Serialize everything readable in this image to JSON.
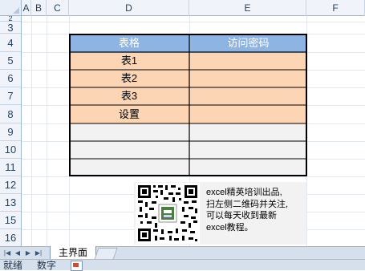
{
  "columns": [
    "A",
    "B",
    "C",
    "D",
    "E",
    "F"
  ],
  "rows": [
    "2",
    "3",
    "4",
    "5",
    "6",
    "7",
    "8",
    "9",
    "10",
    "11",
    "12",
    "13",
    "15",
    "16"
  ],
  "table": {
    "headers": [
      "表格",
      "访问密码"
    ],
    "rows": [
      {
        "name": "表1",
        "password": ""
      },
      {
        "name": "表2",
        "password": ""
      },
      {
        "name": "表3",
        "password": ""
      },
      {
        "name": "设置",
        "password": ""
      },
      {
        "name": "",
        "password": ""
      },
      {
        "name": "",
        "password": ""
      },
      {
        "name": "",
        "password": ""
      }
    ],
    "colors": {
      "header": "#8db4e2",
      "peach": "#fcd5b4",
      "empty": "#f2f2f2"
    }
  },
  "promo": {
    "line1": "excel精英培训出品,",
    "line2": "扫左侧二维码并关注,",
    "line3": "可以每天收到最新",
    "line4": "excel教程。"
  },
  "sheet_tabs": {
    "active": "主界面",
    "nav_buttons": [
      "first",
      "prev",
      "next",
      "last"
    ]
  },
  "status": {
    "ready": "就绪",
    "mode": "数字"
  }
}
